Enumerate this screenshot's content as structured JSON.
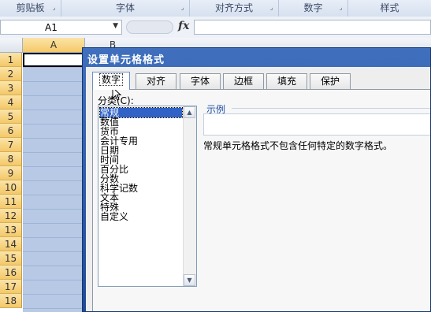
{
  "ribbon": {
    "groups": [
      "剪贴板",
      "字体",
      "对齐方式",
      "数字",
      "样式"
    ]
  },
  "formula_bar": {
    "name_box": "A1",
    "fx_label": "fx",
    "value": ""
  },
  "sheet": {
    "columns": [
      "A",
      "B"
    ],
    "rows": [
      "1",
      "2",
      "3",
      "4",
      "5",
      "6",
      "7",
      "8",
      "9",
      "10",
      "11",
      "12",
      "13",
      "14",
      "15",
      "16",
      "17",
      "18"
    ]
  },
  "dialog": {
    "title": "设置单元格格式",
    "tabs": [
      "数字",
      "对齐",
      "字体",
      "边框",
      "填充",
      "保护"
    ],
    "selected_tab": "数字",
    "category_label": "分类(C):",
    "categories": [
      "常规",
      "数值",
      "货币",
      "会计专用",
      "日期",
      "时间",
      "百分比",
      "分数",
      "科学记数",
      "文本",
      "特殊",
      "自定义"
    ],
    "selected_category": "常规",
    "sample_label": "示例",
    "description": "常规单元格格式不包含任何特定的数字格式。"
  },
  "colors": {
    "dialog_title_bar": "#2f5cae",
    "selection": "#b7c9e4",
    "row_header_highlight": "#f5c969",
    "list_selection": "#3162c5"
  }
}
